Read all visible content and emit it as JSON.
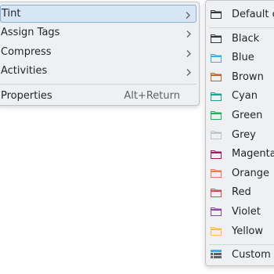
{
  "context_menu": {
    "items": [
      {
        "label": "Tint",
        "has_submenu": true
      },
      {
        "label": "Assign Tags",
        "has_submenu": true
      },
      {
        "label": "Compress",
        "has_submenu": true
      },
      {
        "label": "Activities",
        "has_submenu": true
      },
      {
        "label": "Properties",
        "shortcut": "Alt+Return"
      }
    ]
  },
  "tint_submenu": {
    "default_label": "Default c",
    "colors": [
      {
        "label": "Black",
        "color": "#31363b"
      },
      {
        "label": "Blue",
        "color": "#3daee9"
      },
      {
        "label": "Brown",
        "color": "#c0662d"
      },
      {
        "label": "Cyan",
        "color": "#1ba398"
      },
      {
        "label": "Green",
        "color": "#27ae60"
      },
      {
        "label": "Grey",
        "color": "#bdc3c7"
      },
      {
        "label": "Magenta",
        "color": "#9e1f63"
      },
      {
        "label": "Orange",
        "color": "#f47750"
      },
      {
        "label": "Red",
        "color": "#da4453"
      },
      {
        "label": "Violet",
        "color": "#8e44ad"
      },
      {
        "label": "Yellow",
        "color": "#fdbc4b"
      }
    ],
    "custom_label": "Custom ic"
  }
}
